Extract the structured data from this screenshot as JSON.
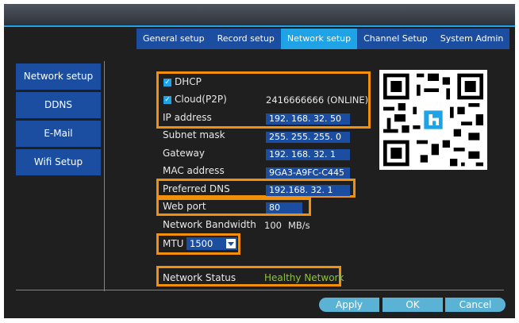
{
  "tabs": [
    "General setup",
    "Record setup",
    "Network setup",
    "Channel Setup",
    "System Admin"
  ],
  "active_tab": "Network setup",
  "sidebar": [
    "Network setup",
    "DDNS",
    "E-Mail",
    "Wifi Setup"
  ],
  "form": {
    "dhcp_label": "DHCP",
    "cloud_label": "Cloud(P2P)",
    "cloud_value": "2416666666  (ONLINE)",
    "ip_label": "IP address",
    "ip_value": "192. 168.  32.  50",
    "subnet_label": "Subnet mask",
    "subnet_value": "255. 255. 255.    0",
    "gateway_label": "Gateway",
    "gateway_value": "192. 168.  32.   1",
    "mac_label": "MAC address",
    "mac_value": "9GA3-A9FC-C445",
    "dns_label": "Preferred DNS",
    "dns_value": "192.168.  32.   1",
    "webport_label": "Web port",
    "webport_value": "80",
    "bandwidth_label": "Network Bandwidth",
    "bandwidth_value": "100",
    "bandwidth_unit": "MB/s",
    "mtu_label": "MTU",
    "mtu_value": "1500",
    "status_label": "Network Status",
    "status_value": "Healthy Network"
  },
  "buttons": {
    "apply": "Apply",
    "ok": "OK",
    "cancel": "Cancel"
  },
  "colors": {
    "accent": "#1fa3e6",
    "field": "#1b4da0",
    "highlight": "#f0900c",
    "status_ok": "#8cc43c"
  },
  "icons": [
    "checkbox-checked-icon",
    "qr-code-icon",
    "dropdown-arrow-icon"
  ]
}
